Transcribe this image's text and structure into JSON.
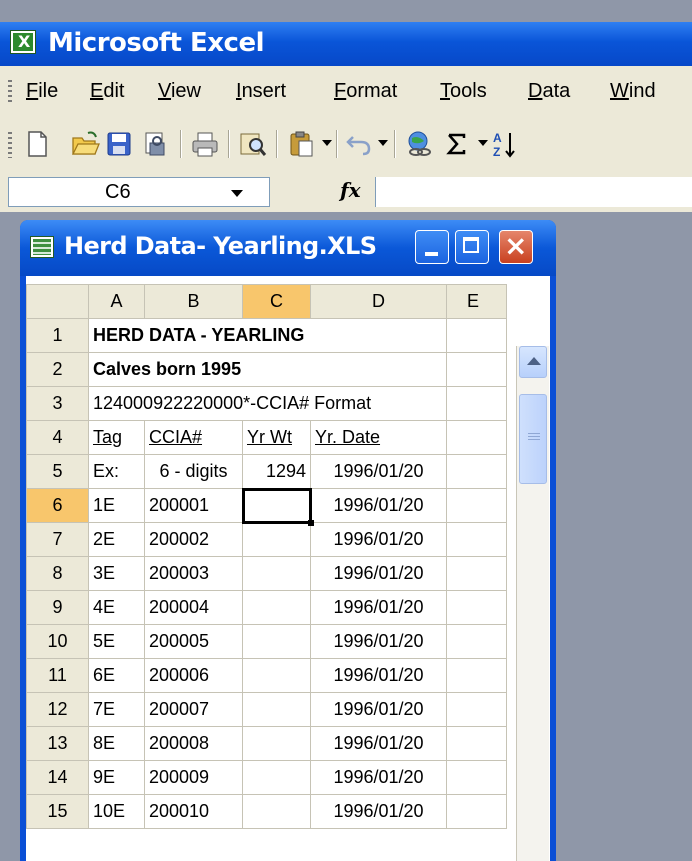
{
  "app": {
    "title": "Microsoft Excel"
  },
  "menubar": {
    "items": [
      "File",
      "Edit",
      "View",
      "Insert",
      "Format",
      "Tools",
      "Data",
      "Wind"
    ]
  },
  "toolbar": {
    "icons": [
      "new-icon",
      "open-icon",
      "save-icon",
      "permission-icon",
      "print-icon",
      "research-icon",
      "paste-icon",
      "undo-icon",
      "insert-hyperlink-icon",
      "autosum-icon",
      "sort-ascending-icon"
    ]
  },
  "formula_bar": {
    "name_box": "C6",
    "fx_label": "fx",
    "formula": ""
  },
  "workbook": {
    "title": "Herd Data- Yearling.XLS",
    "columns": [
      "A",
      "B",
      "C",
      "D",
      "E"
    ],
    "active_column": "C",
    "active_row": "6",
    "rows": [
      {
        "num": "1",
        "a": "HERD DATA - YEARLING"
      },
      {
        "num": "2",
        "a": "Calves born 1995"
      },
      {
        "num": "3",
        "a": "124000922220000*-CCIA# Format"
      },
      {
        "num": "4",
        "a": "Tag",
        "b": "CCIA#",
        "c": "Yr Wt",
        "d": "Yr. Date"
      },
      {
        "num": "5",
        "a": "Ex:",
        "b": "6 - digits",
        "c": "1294",
        "d": "1996/01/20"
      },
      {
        "num": "6",
        "a": "1E",
        "b": "200001",
        "c": "",
        "d": "1996/01/20"
      },
      {
        "num": "7",
        "a": "2E",
        "b": "200002",
        "c": "",
        "d": "1996/01/20"
      },
      {
        "num": "8",
        "a": "3E",
        "b": "200003",
        "c": "",
        "d": "1996/01/20"
      },
      {
        "num": "9",
        "a": "4E",
        "b": "200004",
        "c": "",
        "d": "1996/01/20"
      },
      {
        "num": "10",
        "a": "5E",
        "b": "200005",
        "c": "",
        "d": "1996/01/20"
      },
      {
        "num": "11",
        "a": "6E",
        "b": "200006",
        "c": "",
        "d": "1996/01/20"
      },
      {
        "num": "12",
        "a": "7E",
        "b": "200007",
        "c": "",
        "d": "1996/01/20"
      },
      {
        "num": "13",
        "a": "8E",
        "b": "200008",
        "c": "",
        "d": "1996/01/20"
      },
      {
        "num": "14",
        "a": "9E",
        "b": "200009",
        "c": "",
        "d": "1996/01/20"
      },
      {
        "num": "15",
        "a": "10E",
        "b": "200010",
        "c": "",
        "d": "1996/01/20"
      }
    ]
  }
}
